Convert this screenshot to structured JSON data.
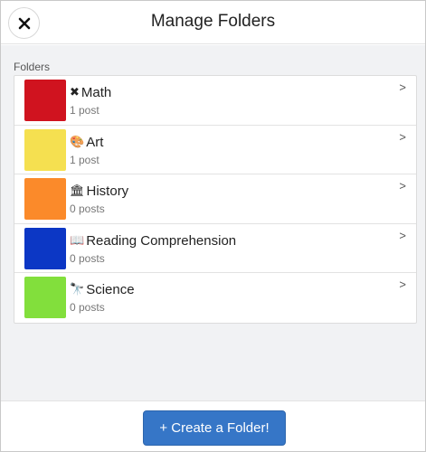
{
  "header": {
    "title": "Manage Folders",
    "close_icon": "close-icon"
  },
  "section_label": "Folders",
  "folders": [
    {
      "icon": "✖",
      "name": "Math",
      "count": "1 post",
      "color": "#d0131f",
      "chevron": ">"
    },
    {
      "icon": "🎨",
      "name": "Art",
      "count": "1 post",
      "color": "#f5e050",
      "chevron": ">"
    },
    {
      "icon": "🏛",
      "name": "History",
      "count": "0 posts",
      "color": "#fb8a2a",
      "chevron": ">"
    },
    {
      "icon": "📖",
      "name": "Reading Comprehension",
      "count": "0 posts",
      "color": "#0c37c5",
      "chevron": ">"
    },
    {
      "icon": "🔭",
      "name": "Science",
      "count": "0 posts",
      "color": "#82df3c",
      "chevron": ">"
    }
  ],
  "footer": {
    "create_label": "+ Create a Folder!",
    "accent": "#3676c7"
  }
}
